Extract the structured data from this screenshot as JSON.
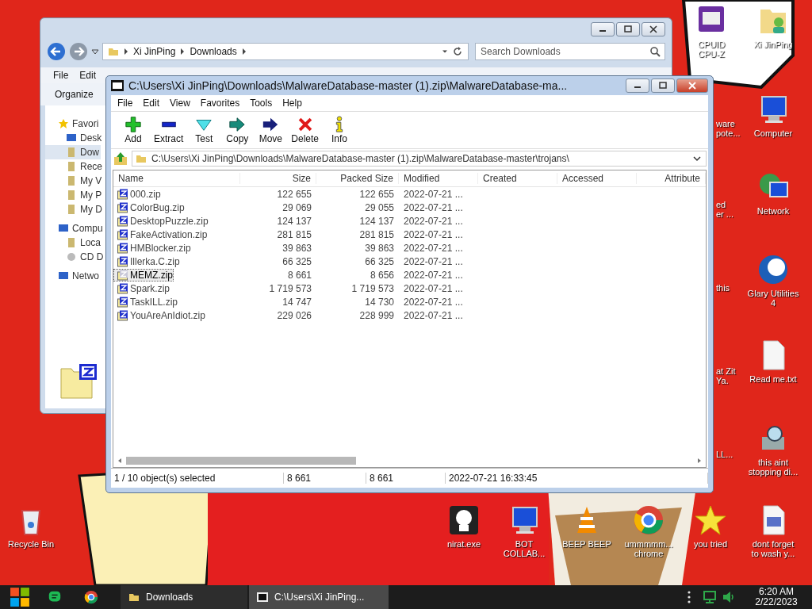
{
  "explorer": {
    "breadcrumb": [
      "Xi JinPing",
      "Downloads"
    ],
    "search": {
      "placeholder": "Search Downloads"
    },
    "menu": [
      "File",
      "Edit"
    ],
    "toolbar": [
      "Organize"
    ],
    "sidebar": [
      {
        "label": "Favori",
        "kind": "group",
        "selected": false
      },
      {
        "label": "Desk",
        "kind": "item",
        "selected": false
      },
      {
        "label": "Dow",
        "kind": "item",
        "selected": true
      },
      {
        "label": "Rece",
        "kind": "item",
        "selected": false
      },
      {
        "label": "My V",
        "kind": "item",
        "selected": false
      },
      {
        "label": "My P",
        "kind": "item",
        "selected": false
      },
      {
        "label": "My D",
        "kind": "item",
        "selected": false
      },
      {
        "label": "Compu",
        "kind": "group",
        "selected": false
      },
      {
        "label": "Loca",
        "kind": "item",
        "selected": false
      },
      {
        "label": "CD D",
        "kind": "item",
        "selected": false
      },
      {
        "label": "Netwo",
        "kind": "group",
        "selected": false
      }
    ]
  },
  "archiver": {
    "title": "C:\\Users\\Xi JinPing\\Downloads\\MalwareDatabase-master (1).zip\\MalwareDatabase-ma...",
    "menu": [
      "File",
      "Edit",
      "View",
      "Favorites",
      "Tools",
      "Help"
    ],
    "toolbar": [
      "Add",
      "Extract",
      "Test",
      "Copy",
      "Move",
      "Delete",
      "Info"
    ],
    "path": "C:\\Users\\Xi JinPing\\Downloads\\MalwareDatabase-master (1).zip\\MalwareDatabase-master\\trojans\\",
    "columns": [
      "Name",
      "Size",
      "Packed Size",
      "Modified",
      "Created",
      "Accessed",
      "Attribute"
    ],
    "rows": [
      {
        "name": "000.zip",
        "size": "122 655",
        "packed": "122 655",
        "modified": "2022-07-21 ...",
        "selected": false
      },
      {
        "name": "ColorBug.zip",
        "size": "29 069",
        "packed": "29 055",
        "modified": "2022-07-21 ...",
        "selected": false
      },
      {
        "name": "DesktopPuzzle.zip",
        "size": "124 137",
        "packed": "124 137",
        "modified": "2022-07-21 ...",
        "selected": false
      },
      {
        "name": "FakeActivation.zip",
        "size": "281 815",
        "packed": "281 815",
        "modified": "2022-07-21 ...",
        "selected": false
      },
      {
        "name": "HMBlocker.zip",
        "size": "39 863",
        "packed": "39 863",
        "modified": "2022-07-21 ...",
        "selected": false
      },
      {
        "name": "Illerka.C.zip",
        "size": "66 325",
        "packed": "66 325",
        "modified": "2022-07-21 ...",
        "selected": false
      },
      {
        "name": "MEMZ.zip",
        "size": "8 661",
        "packed": "8 656",
        "modified": "2022-07-21 ...",
        "selected": true
      },
      {
        "name": "Spark.zip",
        "size": "1 719 573",
        "packed": "1 719 573",
        "modified": "2022-07-21 ...",
        "selected": false
      },
      {
        "name": "TaskILL.zip",
        "size": "14 747",
        "packed": "14 730",
        "modified": "2022-07-21 ...",
        "selected": false
      },
      {
        "name": "YouAreAnIdiot.zip",
        "size": "229 026",
        "packed": "228 999",
        "modified": "2022-07-21 ...",
        "selected": false
      }
    ],
    "status": [
      "1 / 10 object(s) selected",
      "8 661",
      "8 661",
      "2022-07-21 16:33:45"
    ]
  },
  "desktop_icons": [
    {
      "label": "CPUID\nCPU-Z"
    },
    {
      "label": "Xi JinPing"
    },
    {
      "label": "Computer"
    },
    {
      "label": "Network"
    },
    {
      "label": "Glary Utilities\n4"
    },
    {
      "label": "Read me.txt"
    },
    {
      "label": "this aint\nstopping di..."
    },
    {
      "label": "Recycle Bin"
    },
    {
      "label": "nirat.exe"
    },
    {
      "label": "BOT\nCOLLAB..."
    },
    {
      "label": "BEEP BEEP"
    },
    {
      "label": "ummmmm...\nchrome"
    },
    {
      "label": "you tried"
    },
    {
      "label": "dont forget\nto wash y..."
    }
  ],
  "covered_icons": [
    {
      "label": "ware\npote..."
    },
    {
      "label": "ed\ner ..."
    },
    {
      "label": "this"
    },
    {
      "label": "at Zit\nYa."
    },
    {
      "label": "LL..."
    }
  ],
  "taskbar": {
    "tasks": [
      {
        "label": "Downloads",
        "selected": false
      },
      {
        "label": "C:\\Users\\Xi JinPing...",
        "selected": true
      }
    ],
    "time": "6:20 AM",
    "date": "2/22/2023"
  }
}
